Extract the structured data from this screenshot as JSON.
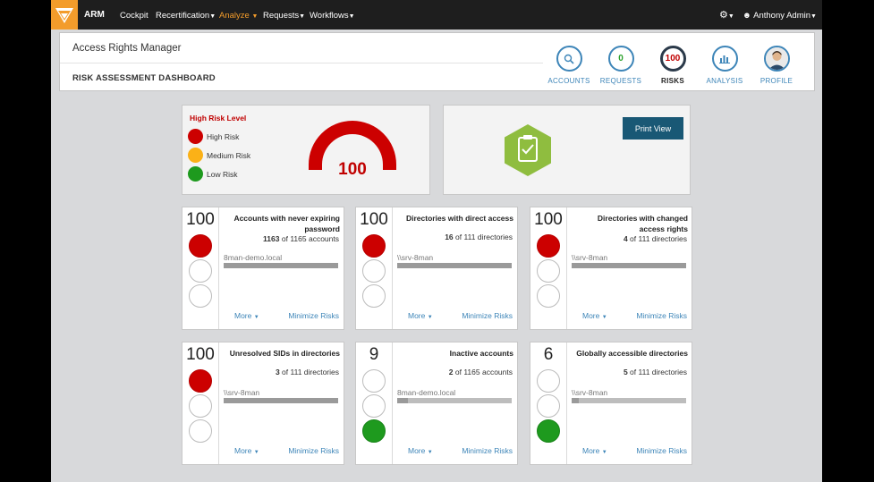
{
  "nav": {
    "brand": "ARM",
    "items": [
      {
        "label": "Cockpit",
        "dropdown": false,
        "active": false
      },
      {
        "label": "Recertification",
        "dropdown": true,
        "active": false
      },
      {
        "label": "Analyze",
        "dropdown": true,
        "active": true
      },
      {
        "label": "Requests",
        "dropdown": true,
        "active": false
      },
      {
        "label": "Workflows",
        "dropdown": true,
        "active": false
      }
    ],
    "user": "Anthony Admin",
    "accent_color": "#f39c2b"
  },
  "header": {
    "app_title": "Access Rights Manager",
    "page_title": "RISK ASSESSMENT DASHBOARD",
    "nav": [
      {
        "label": "ACCOUNTS",
        "icon": "search-icon"
      },
      {
        "label": "REQUESTS",
        "value": "0"
      },
      {
        "label": "RISKS",
        "value": "100"
      },
      {
        "label": "ANALYSIS",
        "icon": "bar-chart-icon"
      },
      {
        "label": "PROFILE",
        "icon": "avatar"
      }
    ]
  },
  "summary": {
    "title": "High Risk Level",
    "legend": [
      "High Risk",
      "Medium Risk",
      "Low Risk"
    ],
    "legend_colors": [
      "#cc0000",
      "#fbb117",
      "#1e9a1e"
    ],
    "gauge_value": "100",
    "print_label": "Print View"
  },
  "cards": [
    {
      "score": "100",
      "level": "high",
      "title": "Accounts with never expiring password",
      "count": "1163",
      "count_suffix": "of 1165 accounts",
      "source": "8man-demo.local",
      "fill": 1.0,
      "more": "More",
      "minimize": "Minimize Risks"
    },
    {
      "score": "100",
      "level": "high",
      "title": "Directories with direct access",
      "count": "16",
      "count_suffix": "of 111 directories",
      "source": "\\\\srv-8man",
      "fill": 1.0,
      "more": "More",
      "minimize": "Minimize Risks"
    },
    {
      "score": "100",
      "level": "high",
      "title": "Directories with changed access rights",
      "count": "4",
      "count_suffix": "of 111 directories",
      "source": "\\\\srv-8man",
      "fill": 1.0,
      "more": "More",
      "minimize": "Minimize Risks"
    },
    {
      "score": "100",
      "level": "high",
      "title": "Unresolved SIDs in directories",
      "count": "3",
      "count_suffix": "of 111 directories",
      "source": "\\\\srv-8man",
      "fill": 1.0,
      "more": "More",
      "minimize": "Minimize Risks"
    },
    {
      "score": "9",
      "level": "low",
      "title": "Inactive accounts",
      "count": "2",
      "count_suffix": "of 1165 accounts",
      "source": "8man-demo.local",
      "fill": 0.09,
      "more": "More",
      "minimize": "Minimize Risks"
    },
    {
      "score": "6",
      "level": "low",
      "title": "Globally accessible directories",
      "count": "5",
      "count_suffix": "of 111 directories",
      "source": "\\\\srv-8man",
      "fill": 0.06,
      "more": "More",
      "minimize": "Minimize Risks"
    }
  ]
}
